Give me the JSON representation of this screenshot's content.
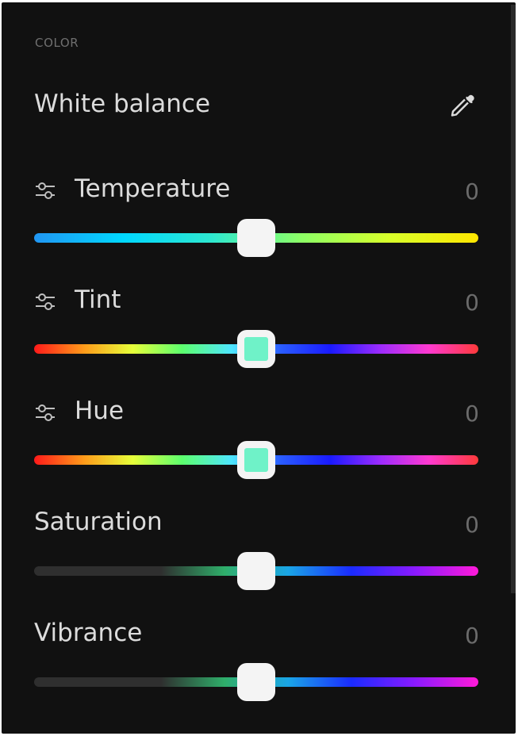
{
  "section": {
    "label": "COLOR"
  },
  "white_balance": {
    "title": "White balance",
    "eyedropper_icon": "eyedropper-icon"
  },
  "sliders": [
    {
      "key": "temperature",
      "label": "Temperature",
      "value": "0",
      "has_adjust_icon": true,
      "adjust_icon": "sliders-icon",
      "level": 0.5,
      "thumb_fill": "#f4f4f4",
      "gradient": [
        "#2196f3",
        "#00d8ff",
        "#2ee8d0",
        "#8cff66",
        "#d8ff2a",
        "#ffe600"
      ]
    },
    {
      "key": "tint",
      "label": "Tint",
      "value": "0",
      "has_adjust_icon": true,
      "adjust_icon": "sliders-icon",
      "level": 0.5,
      "thumb_fill": "#6ff2c8",
      "gradient": [
        "#ff1a1a",
        "#ff9a1a",
        "#e6ff3a",
        "#5cff6e",
        "#4ee6ff",
        "#2a5cff",
        "#1a1aff",
        "#9b2bff",
        "#ff3ad0",
        "#ff3a3a"
      ]
    },
    {
      "key": "hue",
      "label": "Hue",
      "value": "0",
      "has_adjust_icon": true,
      "adjust_icon": "sliders-icon",
      "level": 0.5,
      "thumb_fill": "#6ff2c8",
      "gradient": [
        "#ff1a1a",
        "#ff9a1a",
        "#e6ff3a",
        "#5cff6e",
        "#4ee6ff",
        "#2a5cff",
        "#1a1aff",
        "#9b2bff",
        "#ff3ad0",
        "#ff3a3a"
      ]
    },
    {
      "key": "saturation",
      "label": "Saturation",
      "value": "0",
      "has_adjust_icon": false,
      "level": 0.5,
      "thumb_fill": "#f4f4f4",
      "gradient": [
        "#2f2f2f",
        "#2f2f2f",
        "#2f2f2f",
        "#2fae6a",
        "#1aa6e6",
        "#1a2bff",
        "#8a1aff",
        "#ff1ad8"
      ]
    },
    {
      "key": "vibrance",
      "label": "Vibrance",
      "value": "0",
      "has_adjust_icon": false,
      "level": 0.5,
      "thumb_fill": "#f4f4f4",
      "gradient": [
        "#2f2f2f",
        "#2f2f2f",
        "#2f2f2f",
        "#2fae6a",
        "#1aa6e6",
        "#1a2bff",
        "#8a1aff",
        "#ff1ad8"
      ]
    }
  ],
  "colors": {
    "panel_bg": "#111111",
    "label_text": "#dcdcdc",
    "value_text": "#6b6b6b",
    "section_text": "#6f6f6f",
    "icon": "#bfbfbf"
  }
}
